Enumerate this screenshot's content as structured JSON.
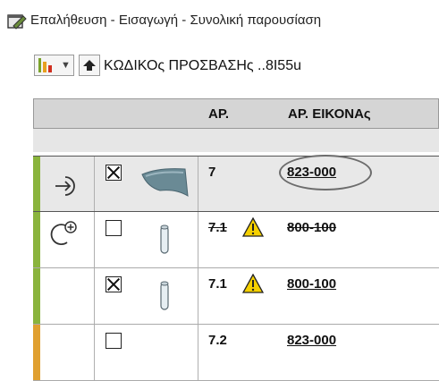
{
  "window": {
    "title": "Επαλήθευση - Εισαγωγή - Συνολική παρουσίαση"
  },
  "toolbar": {
    "breadcrumb": "ΚΩΔΙΚΟς ΠΡΟΣΒΑΣΗς ..8I55u"
  },
  "table": {
    "columns": [
      "ΑΡ.",
      "ΑΡ. ΕΙΚΟΝΑς"
    ],
    "rows": [
      {
        "action_icon": "enter-arrow-icon",
        "checked": true,
        "thumbnail": "body-panel-thumbnail",
        "pos": "7",
        "part_no": "823-000",
        "highlighted": true,
        "warning": false,
        "struck": false,
        "status_color": "#8ab43c"
      },
      {
        "action_icon": "add-refresh-icon",
        "checked": false,
        "thumbnail": "pin-thumbnail",
        "pos": "7.1",
        "part_no": "800-100",
        "warning": true,
        "struck": true,
        "status_color": "#8ab43c"
      },
      {
        "action_icon": "",
        "checked": true,
        "thumbnail": "pin-thumbnail",
        "pos": "7.1",
        "part_no": "800-100",
        "warning": true,
        "struck": false,
        "status_color": "#8ab43c"
      },
      {
        "action_icon": "",
        "checked": false,
        "thumbnail": "",
        "pos": "7.2",
        "part_no": "823-000",
        "warning": false,
        "struck": false,
        "status_color": "#e0a030"
      }
    ]
  },
  "colors": {
    "accent_green": "#8ab43c",
    "accent_orange": "#e0a030",
    "warning_yellow": "#f5d000"
  }
}
